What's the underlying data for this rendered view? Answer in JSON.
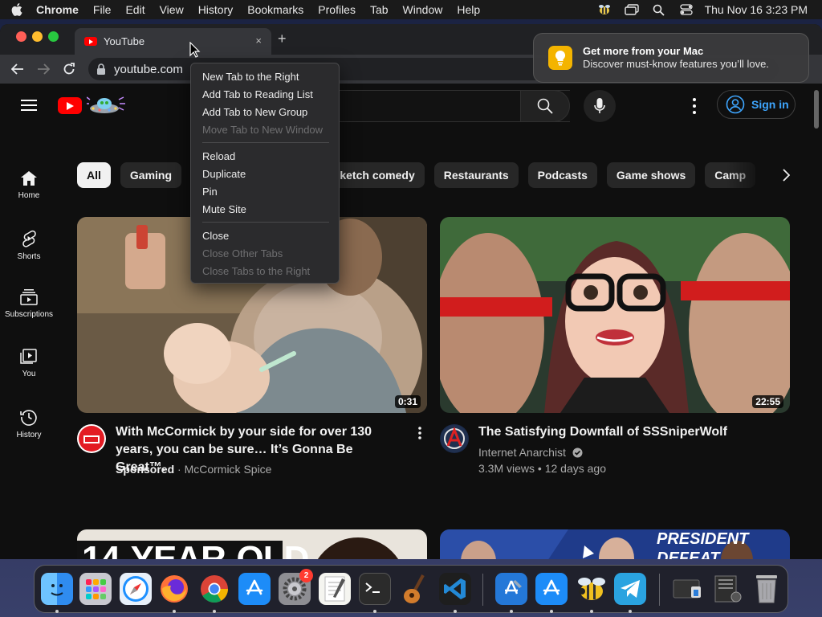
{
  "menubar": {
    "app": "Chrome",
    "items": [
      "File",
      "Edit",
      "View",
      "History",
      "Bookmarks",
      "Profiles",
      "Tab",
      "Window",
      "Help"
    ],
    "clock": "Thu Nov 16  3:23 PM"
  },
  "browser": {
    "tab_title": "YouTube",
    "tab_close": "×",
    "new_tab": "+",
    "address": "youtube.com"
  },
  "context_menu": {
    "groups": [
      [
        {
          "label": "New Tab to the Right",
          "enabled": true
        },
        {
          "label": "Add Tab to Reading List",
          "enabled": true
        },
        {
          "label": "Add Tab to New Group",
          "enabled": true
        },
        {
          "label": "Move Tab to New Window",
          "enabled": false
        }
      ],
      [
        {
          "label": "Reload",
          "enabled": true
        },
        {
          "label": "Duplicate",
          "enabled": true
        },
        {
          "label": "Pin",
          "enabled": true
        },
        {
          "label": "Mute Site",
          "enabled": true
        }
      ],
      [
        {
          "label": "Close",
          "enabled": true
        },
        {
          "label": "Close Other Tabs",
          "enabled": false
        },
        {
          "label": "Close Tabs to the Right",
          "enabled": false
        }
      ]
    ]
  },
  "notification": {
    "title": "Get more from your Mac",
    "body": "Discover must-know features you’ll love."
  },
  "youtube": {
    "signin": "Sign in",
    "sidebar": [
      "Home",
      "Shorts",
      "Subscriptions",
      "You",
      "History"
    ],
    "chips": [
      "All",
      "Gaming",
      "",
      "",
      "Sketch comedy",
      "Restaurants",
      "Podcasts",
      "Game shows",
      "Camp"
    ],
    "videos": [
      {
        "title": "With McCormick by your side for over 130 years, you can be sure… It’s Gonna Be Great™.",
        "duration": "0:31",
        "sponsored": "Sponsored",
        "meta": "· McCormick Spice"
      },
      {
        "title": "The Satisfying Downfall of SSSniperWolf",
        "duration": "22:55",
        "channel": "Internet Anarchist",
        "meta": "3.3M views • 12 days ago"
      }
    ],
    "thumb3_text": "14-YEAR-OLD",
    "thumb4_text": "PRESIDENT DEFEAT"
  },
  "dock": {
    "apps": [
      "Finder",
      "Launchpad",
      "Safari",
      "Firefox",
      "Chrome",
      "App Store",
      "System Settings",
      "TextEdit",
      "Terminal",
      "GarageBand",
      "VS Code",
      "Xcode",
      "App Store",
      "Cyberduck",
      "Telegram",
      "Downloads",
      "Documents",
      "Trash"
    ],
    "settings_badge": "2"
  },
  "colors": {
    "youtube_red": "#ff0000",
    "link_blue": "#3ea6ff",
    "menu_bg": "#2b2b2d"
  }
}
